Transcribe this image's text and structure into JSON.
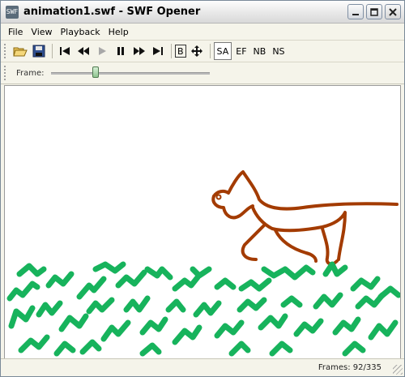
{
  "window": {
    "title": "animation1.swf - SWF Opener",
    "app_icon_text": "SWF"
  },
  "menu": [
    "File",
    "View",
    "Playback",
    "Help"
  ],
  "toolbar": {
    "text_buttons": [
      "B",
      "SA",
      "EF",
      "NB",
      "NS"
    ],
    "active": "SA"
  },
  "frame_control": {
    "label": "Frame:",
    "position_fraction": 0.27
  },
  "status": {
    "text": "Frames: 92/335",
    "current_frame": 92,
    "total_frames": 335
  },
  "colors": {
    "animal": "#a33b00",
    "grass": "#17b35c"
  }
}
